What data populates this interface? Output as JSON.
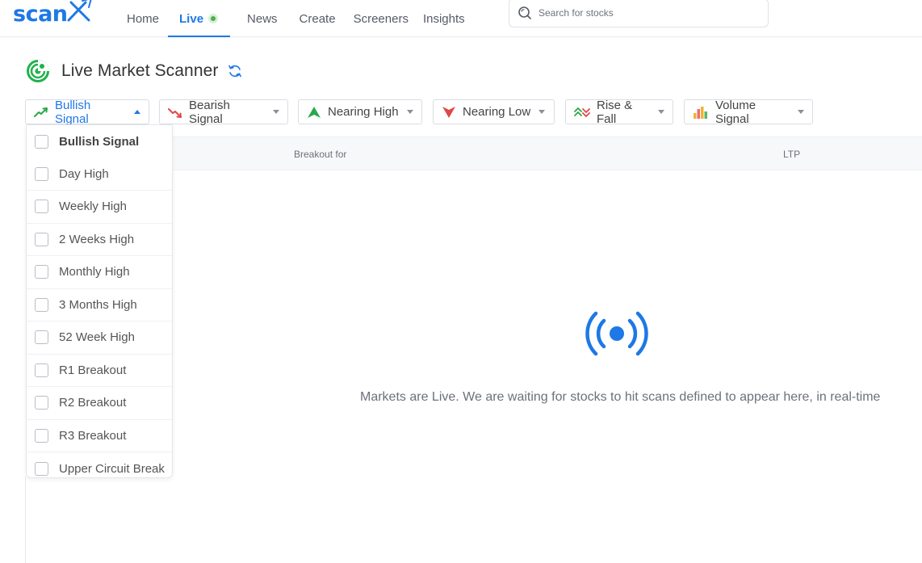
{
  "brand": {
    "logo_text": "scan",
    "accent_color": "#1e78e6"
  },
  "nav": {
    "items": [
      {
        "label": "Home"
      },
      {
        "label": "Live",
        "active": true
      },
      {
        "label": "News"
      },
      {
        "label": "Create"
      },
      {
        "label": "Screeners"
      },
      {
        "label": "Insights"
      }
    ]
  },
  "search": {
    "placeholder": "Search for stocks",
    "icon": "search-icon"
  },
  "page": {
    "title": "Live Market Scanner",
    "refresh_icon": "refresh-icon"
  },
  "filters": [
    {
      "label": "Bullish Signal",
      "icon": "trend-up-icon",
      "open": true
    },
    {
      "label": "Bearish Signal",
      "icon": "trend-down-icon"
    },
    {
      "label": "Nearing High",
      "icon": "arrow-up-icon"
    },
    {
      "label": "Nearing Low",
      "icon": "arrow-down-icon"
    },
    {
      "label": "Rise & Fall",
      "icon": "rise-fall-icon"
    },
    {
      "label": "Volume Signal",
      "icon": "bar-chart-icon"
    }
  ],
  "dropdown": {
    "options": [
      {
        "label": "Bullish Signal",
        "checked": false
      },
      {
        "label": "Day High",
        "checked": false
      },
      {
        "label": "Weekly High",
        "checked": false
      },
      {
        "label": "2 Weeks High",
        "checked": false
      },
      {
        "label": "Monthly High",
        "checked": false
      },
      {
        "label": "3 Months High",
        "checked": false
      },
      {
        "label": "52 Week High",
        "checked": false
      },
      {
        "label": "R1 Breakout",
        "checked": false
      },
      {
        "label": "R2 Breakout",
        "checked": false
      },
      {
        "label": "R3 Breakout",
        "checked": false
      },
      {
        "label": "Upper Circuit Break",
        "checked": false
      }
    ]
  },
  "table": {
    "columns": [
      "Breakout for",
      "LTP"
    ]
  },
  "empty_state": {
    "icon": "broadcast-icon",
    "message": "Markets are Live. We are waiting for stocks to hit scans defined to appear here, in real-time"
  }
}
